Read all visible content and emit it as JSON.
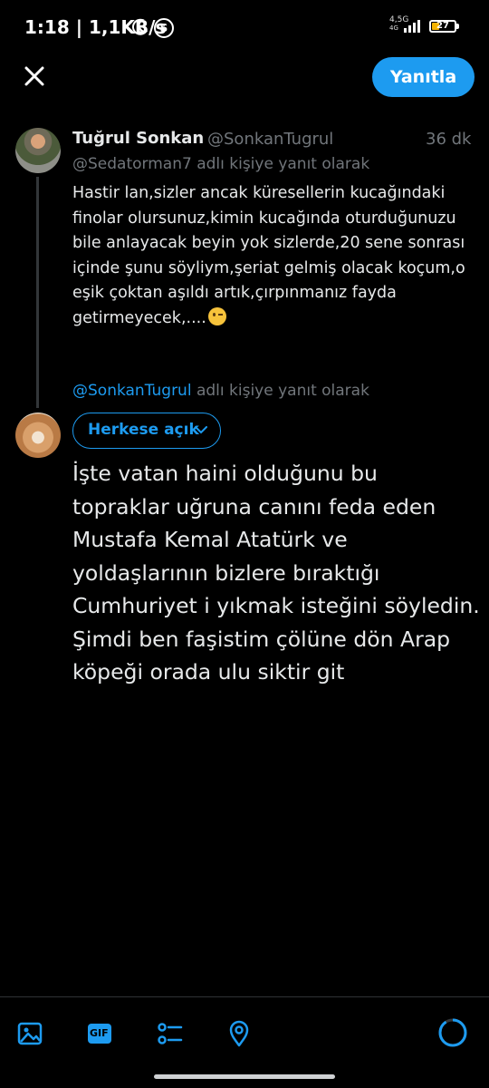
{
  "status_bar": {
    "time": "1:18 | 1,1KB/s",
    "network_top": "4,5G",
    "network_bottom": "4G",
    "battery": "27"
  },
  "header": {
    "reply_button_label": "Yanıtla"
  },
  "original_tweet": {
    "author_name": "Tuğrul Sonkan",
    "author_handle": "@SonkanTugrul",
    "time_ago": "36 dk",
    "reply_to_mention": "@Sedatorman7",
    "reply_to_suffix": " adlı kişiye yanıt olarak",
    "body": "Hastir lan,sizler ancak küresellerin kucağındaki finolar olursunuz,kimin kucağında oturduğunuzu bile anlayacak beyin yok sizlerde,20 sene sonrası içinde şunu söyliym,şeriat gelmiş olacak koçum,o eşik çoktan aşıldı artık,çırpınmanız fayda getirmeyecek,...."
  },
  "compose": {
    "reply_to_mention": "@SonkanTugrul",
    "reply_to_suffix": " adlı kişiye yanıt olarak",
    "audience_label": "Herkese açık",
    "text": "İşte vatan haini olduğunu bu topraklar uğruna canını feda eden Mustafa Kemal Atatürk ve yoldaşlarının bizlere bıraktığı Cumhuriyet i yıkmak isteğini söyledin. Şimdi ben faşistim çölüne dön Arap köpeği orada ulu siktir git"
  },
  "toolbar": {
    "icons": [
      "image-icon",
      "gif-icon",
      "poll-icon",
      "location-icon"
    ],
    "gif_label": "GIF"
  },
  "colors": {
    "accent": "#1d9bf0",
    "background": "#000000",
    "secondary_text": "#71767b"
  }
}
